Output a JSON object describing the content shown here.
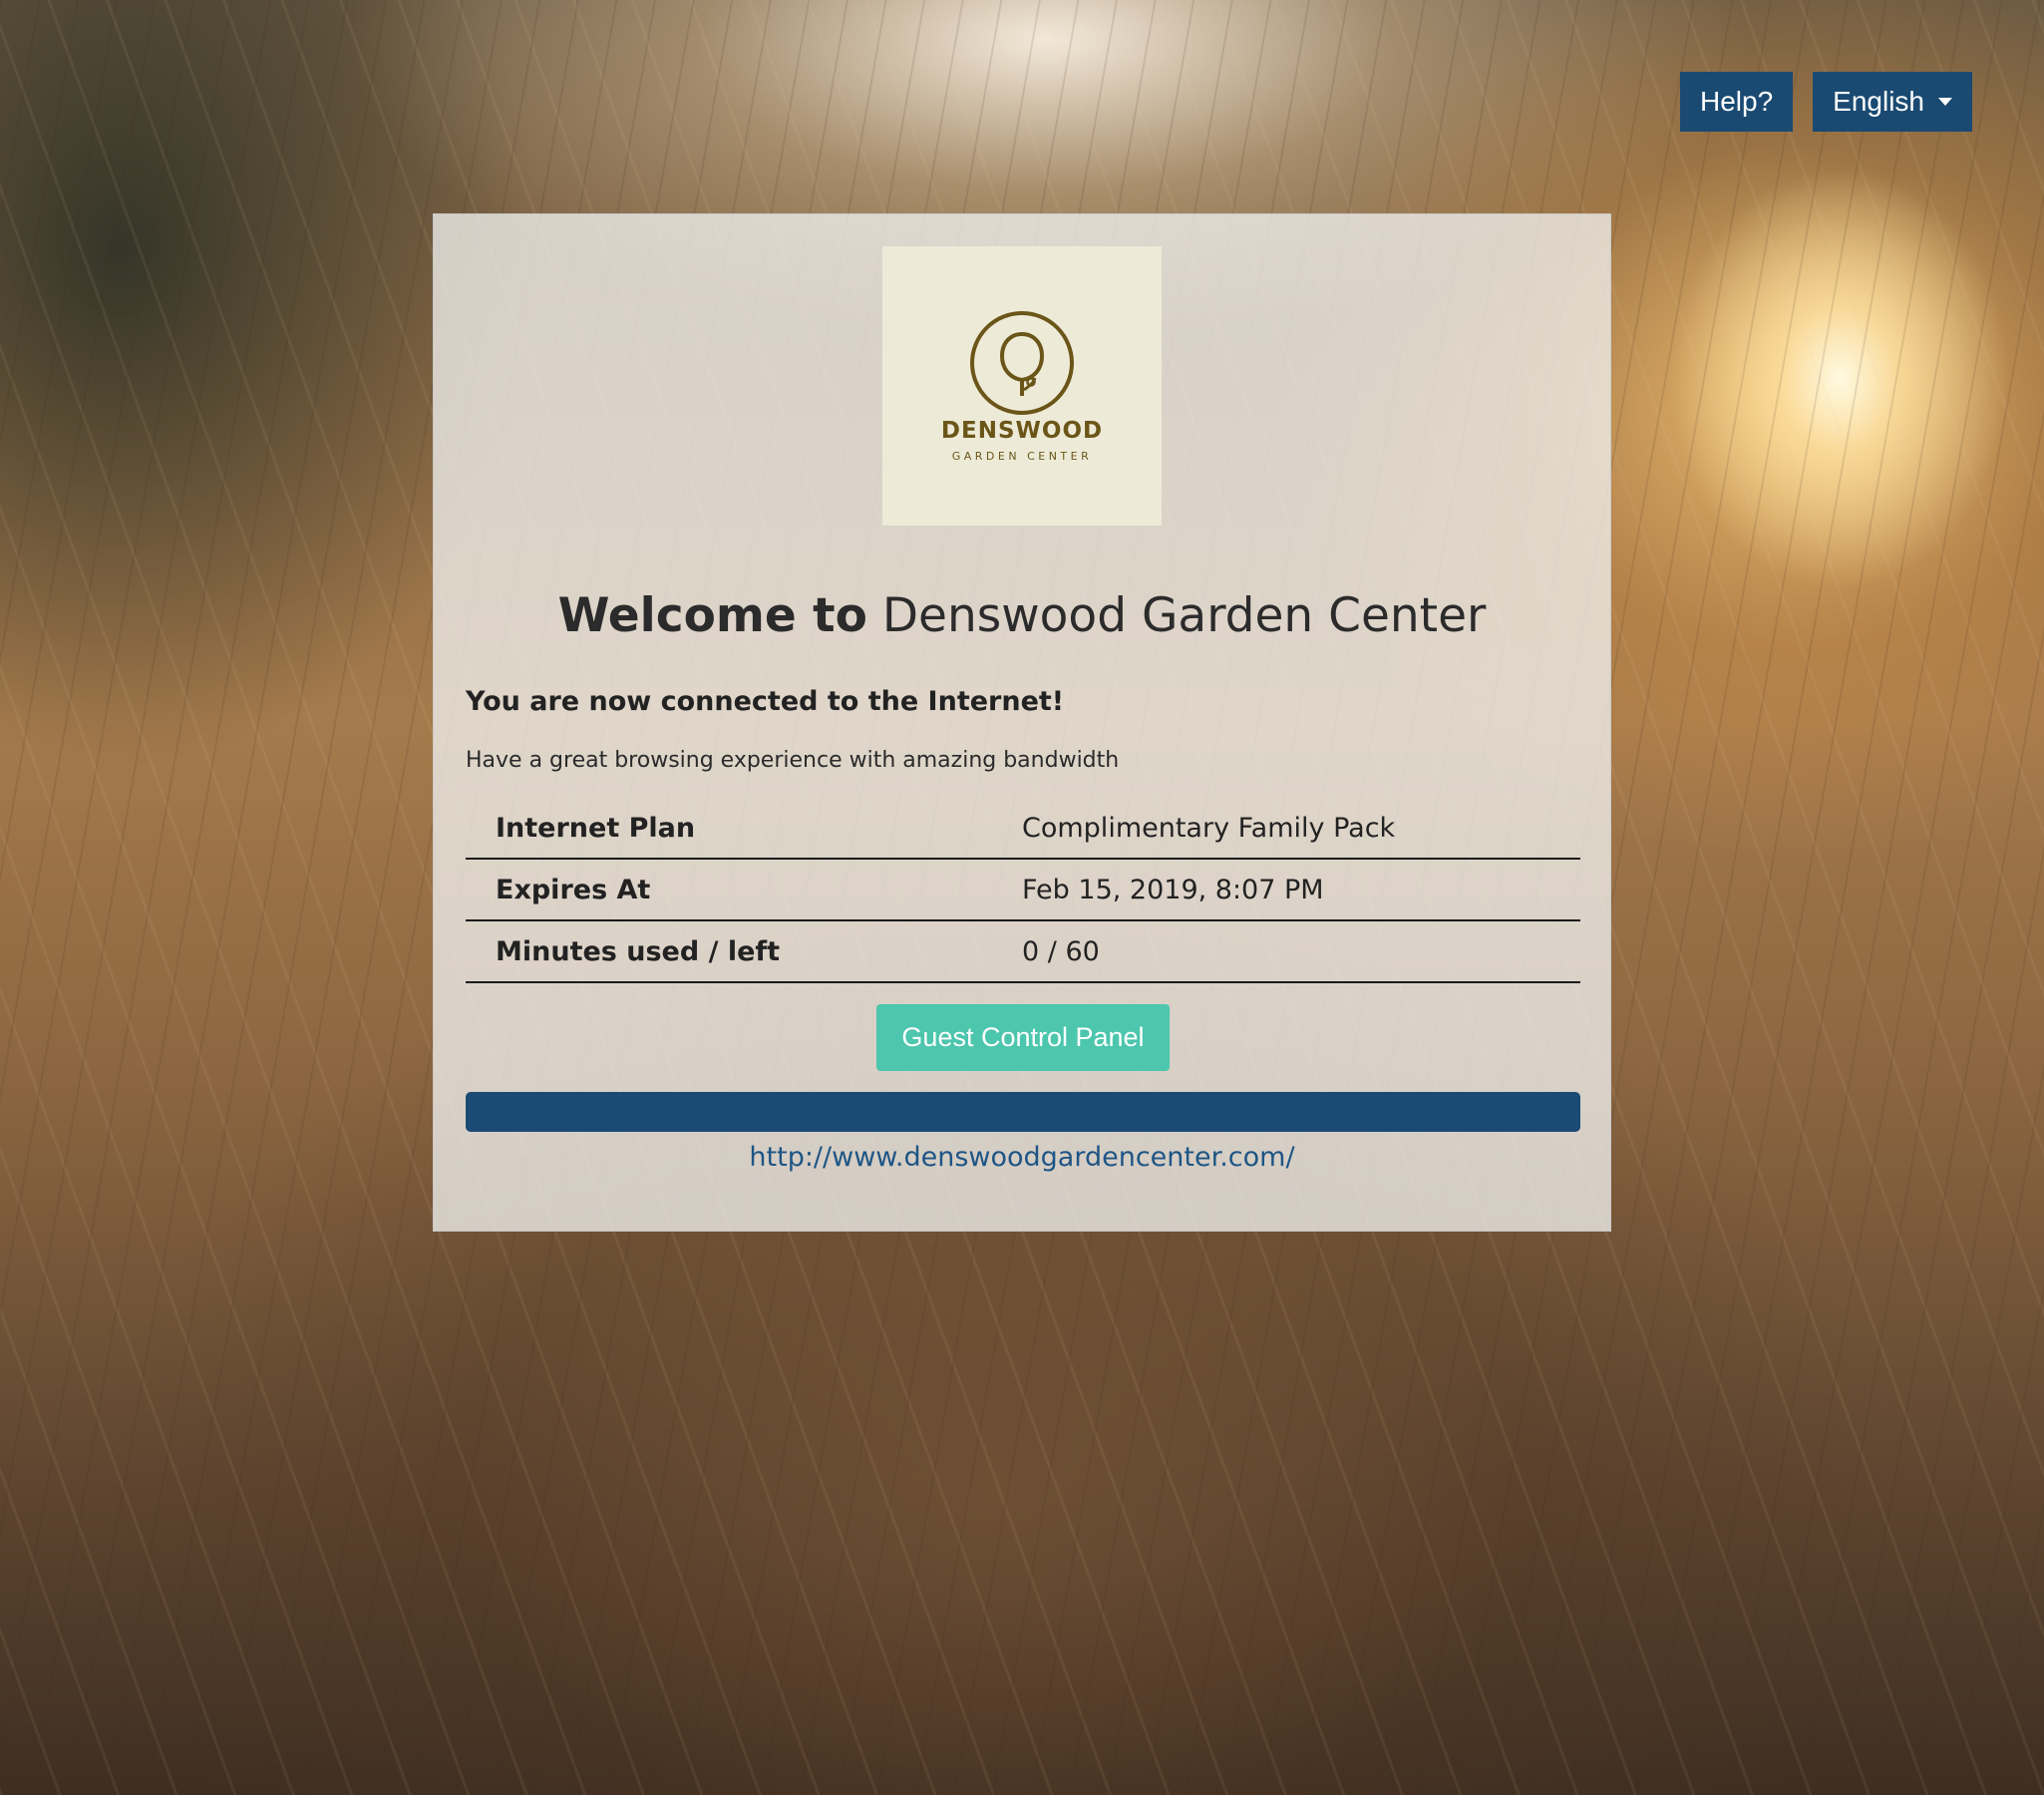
{
  "header": {
    "help_label": "Help?",
    "language_label": "English"
  },
  "logo": {
    "name": "DENSWOOD",
    "tagline": "GARDEN CENTER"
  },
  "card": {
    "welcome_prefix": "Welcome to",
    "venue_name": "Denswood Garden Center",
    "connected_message": "You are now connected to the Internet!",
    "subline": "Have a great browsing experience with amazing bandwidth",
    "info_rows": [
      {
        "label": "Internet Plan",
        "value": "Complimentary Family Pack"
      },
      {
        "label": "Expires At",
        "value": "Feb 15, 2019, 8:07 PM"
      },
      {
        "label": "Minutes used / left",
        "value": "0 / 60"
      }
    ],
    "guest_button_label": "Guest Control Panel",
    "website_link": "http://www.denswoodgardencenter.com/"
  },
  "colors": {
    "primary_blue": "#1a4a72",
    "accent_teal": "#4cc6ad",
    "logo_gold": "#6b5518"
  },
  "icons": {
    "language_dropdown": "caret-down-icon",
    "logo": "tree-logo-icon"
  }
}
